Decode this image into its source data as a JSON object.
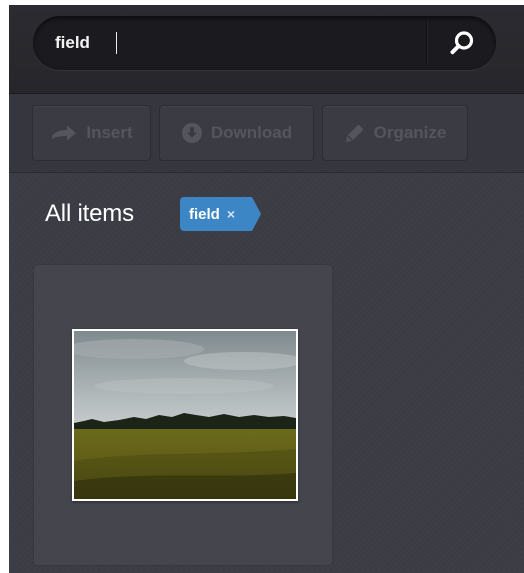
{
  "search": {
    "query": "field",
    "button_icon": "magnifier-icon"
  },
  "toolbar": {
    "insert_label": "Insert",
    "download_label": "Download",
    "organize_label": "Organize",
    "disabled_color": "#55555e"
  },
  "main": {
    "heading": "All items",
    "filter_tag": {
      "label": "field",
      "remove_glyph": "×",
      "color": "#3d86c6"
    }
  },
  "items": [
    {
      "kind": "image",
      "depicts": "field-landscape-thumbnail"
    }
  ]
}
